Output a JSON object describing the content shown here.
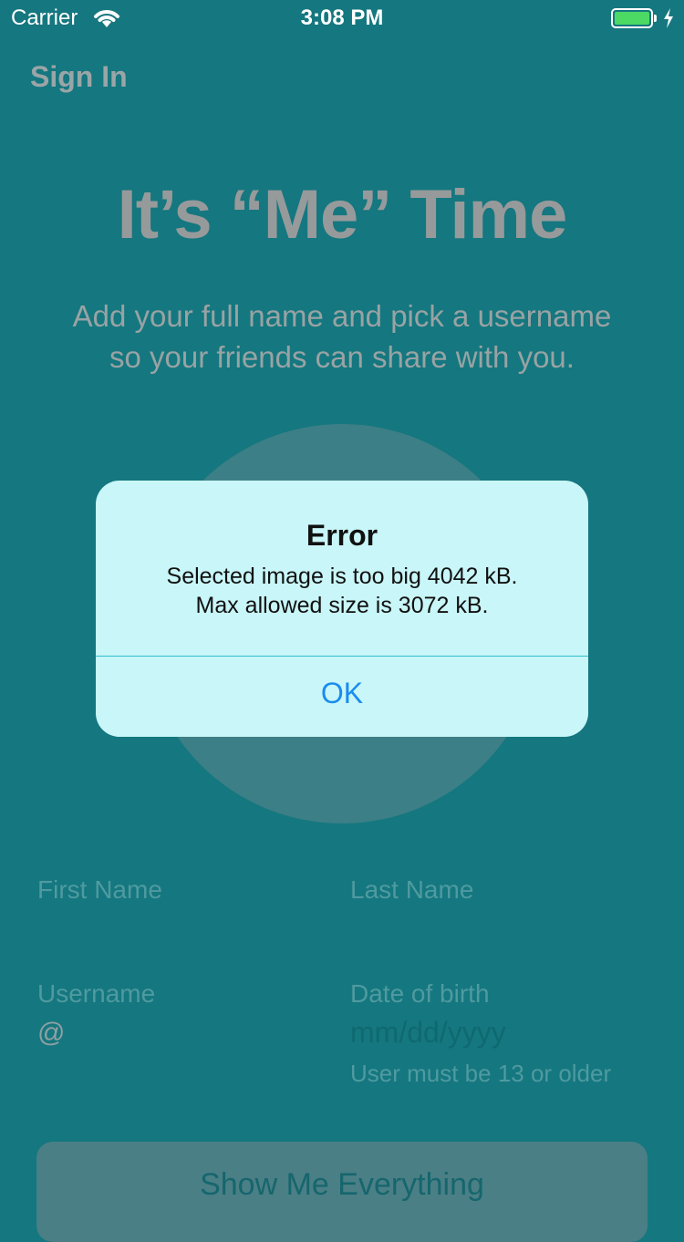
{
  "status_bar": {
    "carrier": "Carrier",
    "time": "3:08 PM",
    "wifi_icon": "wifi-icon",
    "battery_icon": "battery-icon",
    "charging_icon": "charging-bolt-icon",
    "battery_color": "#4cd964"
  },
  "nav": {
    "sign_in": "Sign In"
  },
  "header": {
    "title": "It’s “Me” Time",
    "subtitle_line1": "Add your full name and pick a username",
    "subtitle_line2": "so your friends can share with you."
  },
  "form": {
    "first_name_label": "First Name",
    "last_name_label": "Last Name",
    "username_label": "Username",
    "username_prefix": "@",
    "dob_label": "Date of birth",
    "dob_placeholder": "mm/dd/yyyy",
    "dob_helper": "User must be 13 or older"
  },
  "cta": {
    "label": "Show Me Everything"
  },
  "alert": {
    "title": "Error",
    "message_line1": "Selected image is too big 4042 kB.",
    "message_line2": "Max allowed size is 3072 kB.",
    "ok_label": "OK"
  },
  "colors": {
    "background": "#15777f",
    "alert_background": "#c9f6f8",
    "alert_button_text": "#1a8cf0"
  }
}
